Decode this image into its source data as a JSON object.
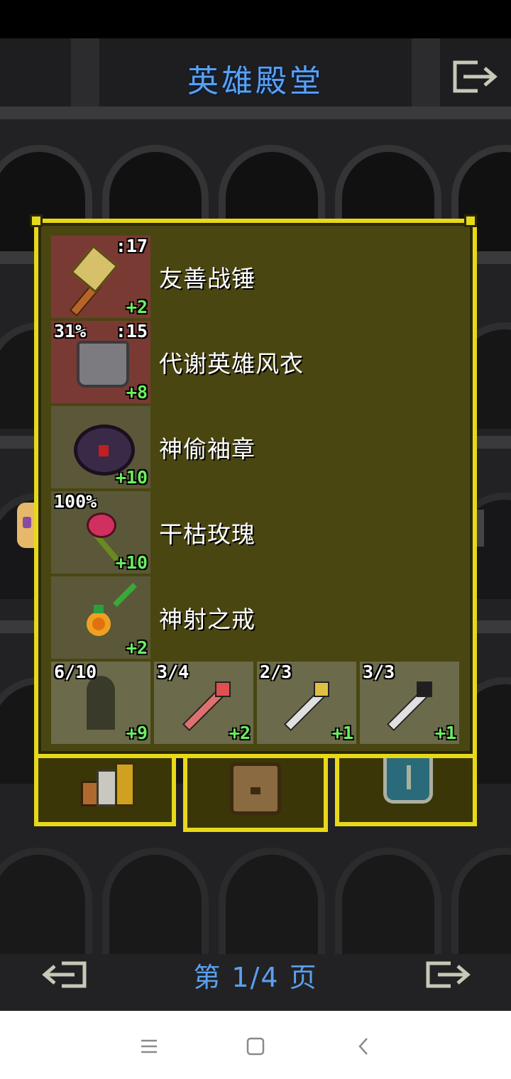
{
  "title": "英雄殿堂",
  "icons": {
    "exit": "exit-icon",
    "prev": "arrow-left-icon",
    "next": "arrow-right-icon"
  },
  "pagination": {
    "label": "第 1/4 页"
  },
  "items": [
    {
      "name": "友善战锤",
      "top_left": "",
      "top_right": ":17",
      "bottom_right": "+2",
      "sprite": "hammer-icon"
    },
    {
      "name": "代谢英雄风衣",
      "top_left": "31%",
      "top_right": ":15",
      "bottom_right": "+8",
      "sprite": "armor-icon"
    },
    {
      "name": "神偷袖章",
      "top_left": "",
      "top_right": "",
      "bottom_right": "+10",
      "sprite": "cloak-icon"
    },
    {
      "name": "干枯玫瑰",
      "top_left": "100%",
      "top_right": "",
      "bottom_right": "+10",
      "sprite": "rose-icon"
    },
    {
      "name": "神射之戒",
      "top_left": "",
      "top_right": "",
      "bottom_right": "+2",
      "sprite": "ring-icon"
    }
  ],
  "quickslots": [
    {
      "top_left": "6/10",
      "bottom_right": "+9",
      "sprite": "ghost-artifact-icon"
    },
    {
      "top_left": "3/4",
      "bottom_right": "+2",
      "sprite": "wand-icon"
    },
    {
      "top_left": "2/3",
      "bottom_right": "+1",
      "sprite": "wand-icon"
    },
    {
      "top_left": "3/3",
      "bottom_right": "+1",
      "sprite": "wand-icon"
    }
  ],
  "tabs": [
    {
      "icon": "books-icon"
    },
    {
      "icon": "backpack-icon"
    },
    {
      "icon": "shield-icon"
    }
  ],
  "colors": {
    "accent_blue": "#5aa0f0",
    "panel_border": "#e8d81a",
    "panel_bg": "#4a4612",
    "upgrade_green": "#6af060"
  },
  "system_nav": {
    "menu": "menu-icon",
    "home": "home-icon",
    "back": "back-icon"
  }
}
